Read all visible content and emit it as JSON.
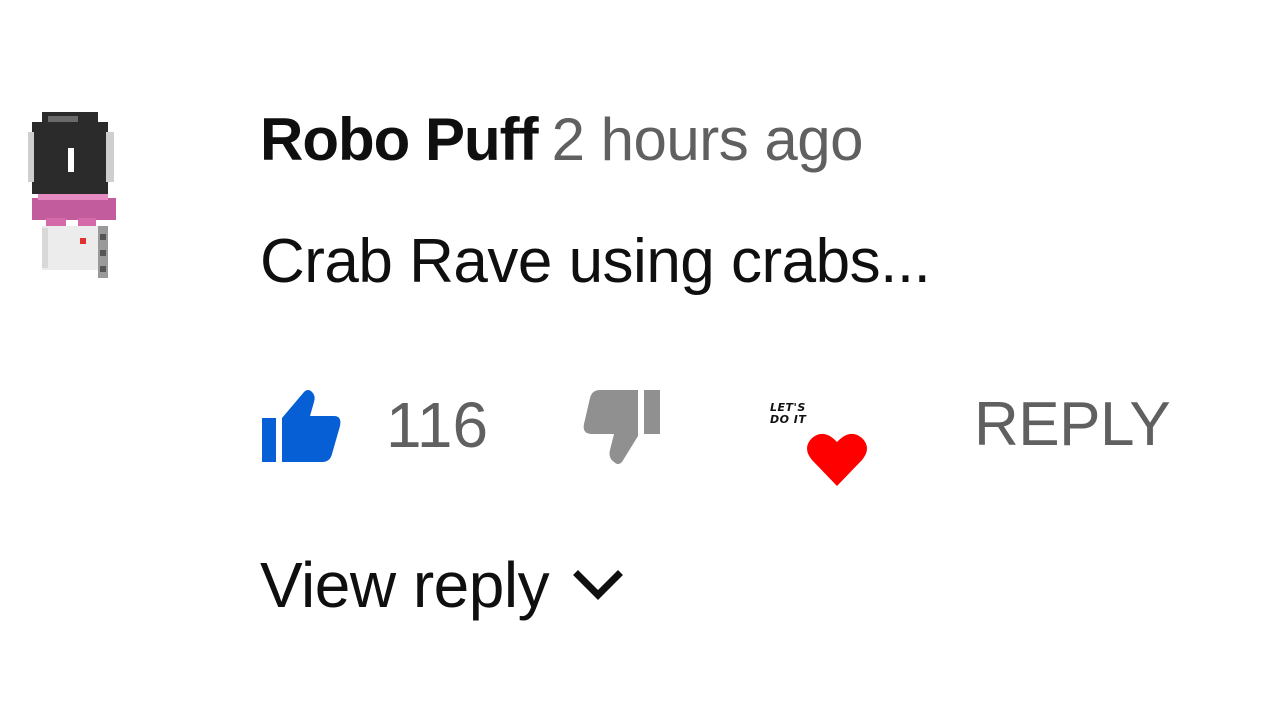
{
  "comment": {
    "author": "Robo Puff",
    "timestamp": "2 hours ago",
    "text": "Crab Rave using crabs...",
    "avatar_icon": "pixel-robot-avatar"
  },
  "actions": {
    "like_icon": "thumb-up-icon",
    "like_count": "116",
    "like_state": "liked",
    "like_color": "#065fd4",
    "dislike_icon": "thumb-down-icon",
    "heart_icon": "creator-heart-icon",
    "heart_color": "#ff0000",
    "heart_badge_text_line1": "LET'S",
    "heart_badge_text_line2": "DO IT",
    "reply_label": "REPLY"
  },
  "replies": {
    "view_label": "View reply",
    "toggle_icon": "chevron-down-icon"
  },
  "colors": {
    "primary_text": "#0f0f0f",
    "secondary_text": "#606060",
    "background": "#ffffff"
  }
}
